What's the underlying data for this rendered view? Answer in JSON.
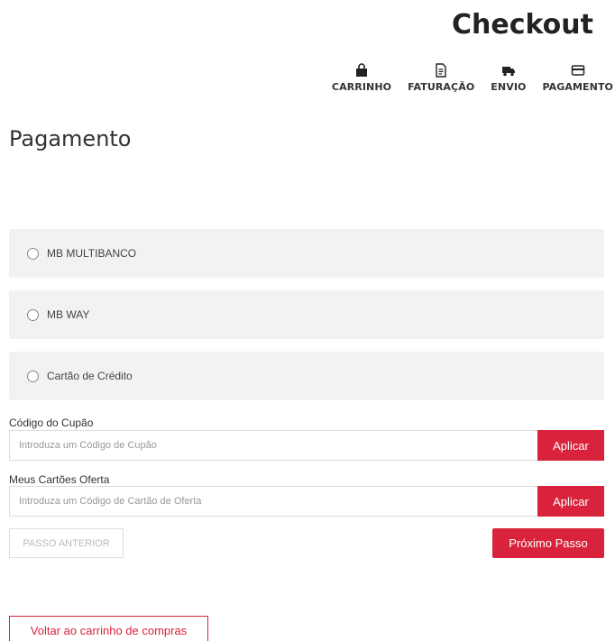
{
  "page": {
    "title": "Checkout"
  },
  "steps": [
    {
      "label": "CARRINHO",
      "icon": "shopping-bag-icon"
    },
    {
      "label": "FATURAÇÃO",
      "icon": "invoice-icon"
    },
    {
      "label": "ENVIO",
      "icon": "truck-icon"
    },
    {
      "label": "PAGAMENTO",
      "icon": "credit-card-icon"
    }
  ],
  "payment": {
    "title": "Pagamento",
    "methods": [
      {
        "label": "MB MULTIBANCO"
      },
      {
        "label": "MB WAY"
      },
      {
        "label": "Cartão de Crédito"
      }
    ]
  },
  "coupon": {
    "label": "Código do Cupão",
    "placeholder": "Introduza um Código de Cupão",
    "button": "Aplicar"
  },
  "gift_card": {
    "label": "Meus Cartões Oferta",
    "placeholder": "Introduza um Código de Cartão de Oferta",
    "button": "Aplicar"
  },
  "nav": {
    "prev": "PASSO ANTERIOR",
    "next": "Próximo Passo",
    "back_to_cart": "Voltar ao carrinho de compras"
  },
  "colors": {
    "accent": "#d9233d",
    "panel": "#f2f2f2"
  }
}
